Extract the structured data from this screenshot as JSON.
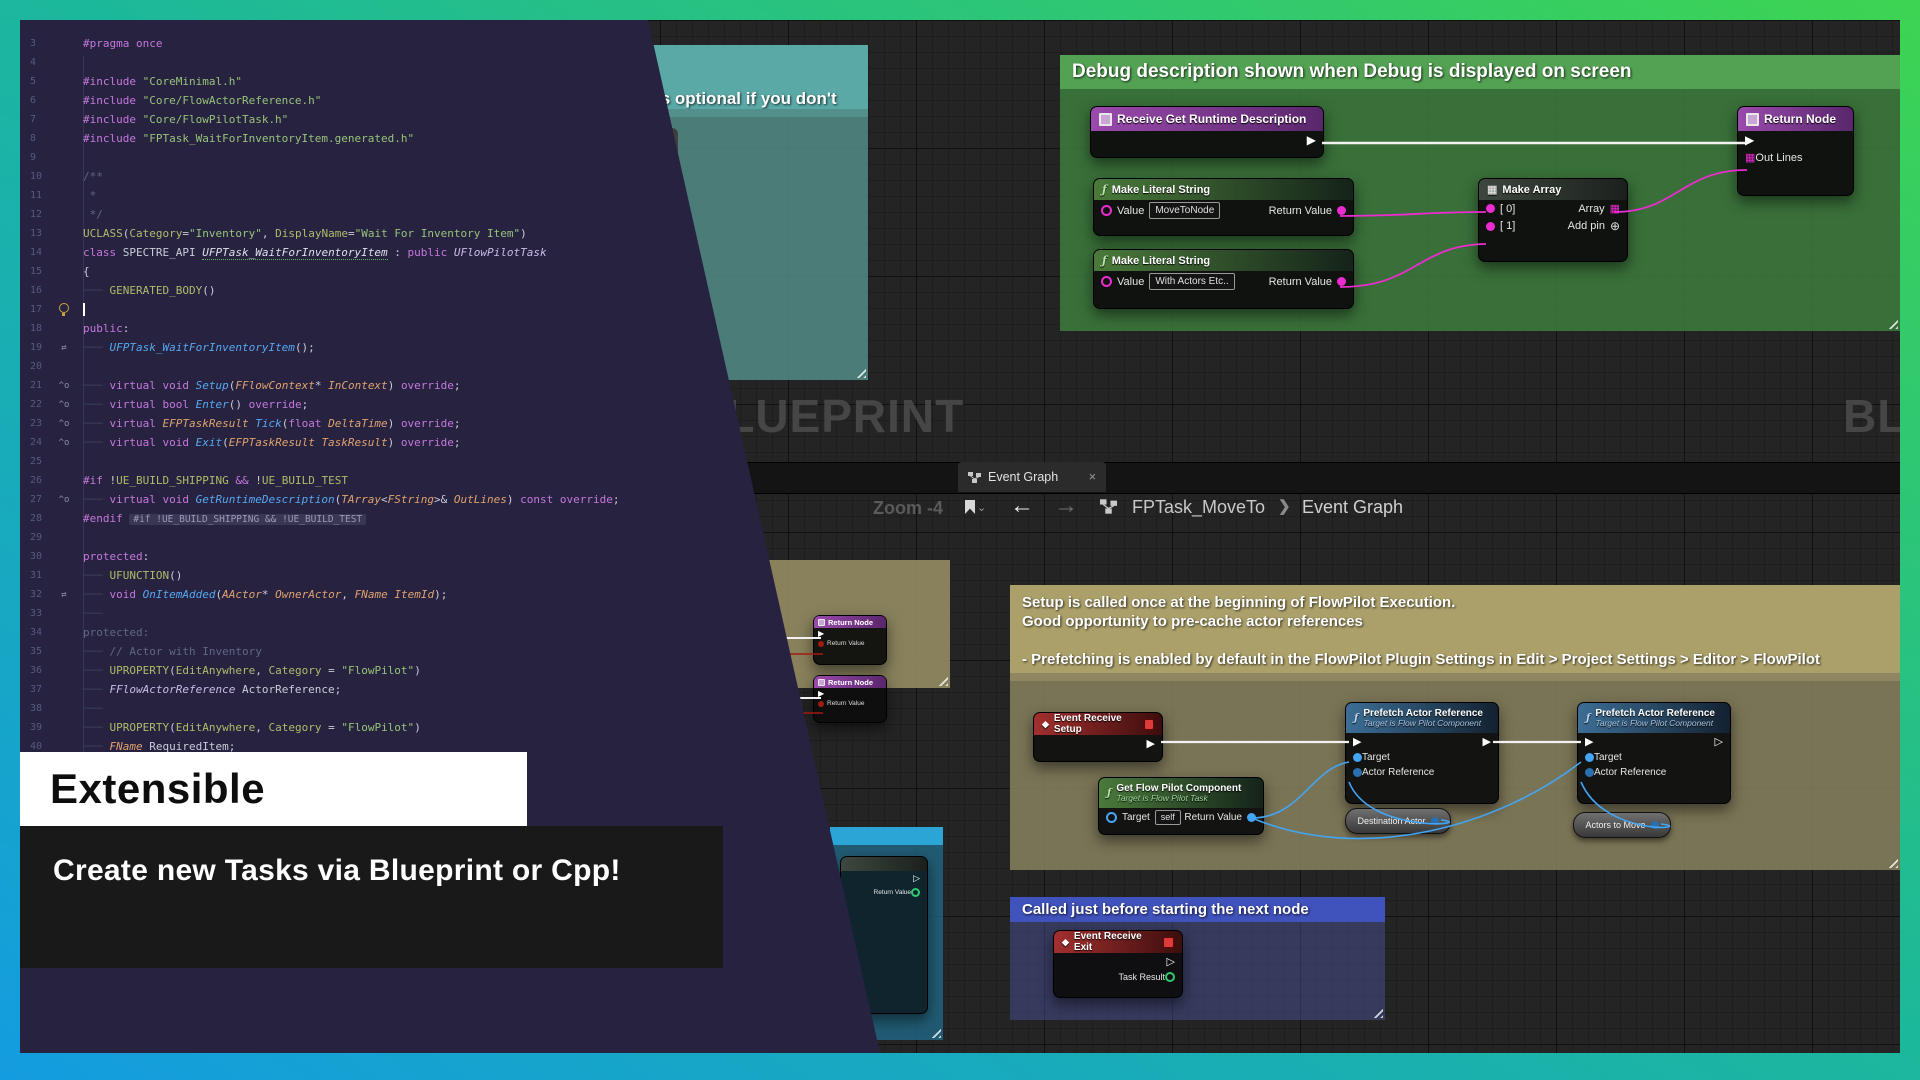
{
  "banners": {
    "title": "Extensible",
    "subtitle": "Create new Tasks via Blueprint or Cpp!"
  },
  "watermark": "BLUEPRINT",
  "ui": {
    "tab": "Event Graph",
    "zoom_label": "Zoom -4",
    "breadcrumb_parent": "FPTask_MoveTo",
    "breadcrumb_child": "Event Graph"
  },
  "icons": {
    "exec": "▶",
    "exec_hollow": "▷",
    "diamond": "◆",
    "fn": "ƒ",
    "grid": "▦",
    "add": "⊕",
    "close": "×",
    "chevron": "❯",
    "back": "←",
    "fwd": "→",
    "caret_down": "⌄"
  },
  "comments": {
    "debug": "Debug description shown when Debug is displayed on screen",
    "optional": "is optional if you don't",
    "setup_line1": "Setup is called once at the beginning of FlowPilot Execution.",
    "setup_line2": "Good opportunity to pre-cache actor references",
    "setup_line3": "- Prefetching is enabled by default in the FlowPilot Plugin Settings in Edit > Project Settings > Editor > FlowPilot",
    "exit": "Called just before starting the next node"
  },
  "nodes": {
    "receive": "Receive Get Runtime Description",
    "return_node": "Return Node",
    "out_lines": "Out Lines",
    "make_literal_string": "Make Literal String",
    "value": "Value",
    "mls1_value": "MoveToNode",
    "mls2_value": "With Actors Etc..",
    "return_value": "Return Value",
    "make_array": "Make Array",
    "idx0": "[ 0]",
    "idx1": "[ 1]",
    "array": "Array",
    "add_pin": "Add pin",
    "event_setup": "Event Receive Setup",
    "get_fpc": "Get Flow Pilot Component",
    "target_is_task": "Target is Flow Pilot Task",
    "target_is_comp": "Target is Flow Pilot Component",
    "target": "Target",
    "self_value": "self",
    "prefetch": "Prefetch Actor Reference",
    "actor_reference": "Actor Reference",
    "destination_actor": "Destination Actor",
    "actors_to_move": "Actors to Move",
    "event_exit": "Event Receive Exit",
    "task_result": "Task Result"
  },
  "colors": {
    "accent_green": "#3ed452",
    "accent_teal": "#1cb89b",
    "accent_blue": "#149ce0",
    "comment_green": "#53a253",
    "comment_tan": "#aca06a",
    "comment_blue": "#4052bb",
    "comment_teal": "#5aa9a6",
    "wire_pink": "#ec2bd0",
    "wire_blue": "#42a5f5",
    "wire_red": "#a11b10"
  },
  "editor": {
    "lines": [
      {
        "n": 3,
        "i": "",
        "s": [
          [
            "cp",
            "#pragma once"
          ]
        ]
      },
      {
        "n": 4,
        "i": "",
        "s": []
      },
      {
        "n": 5,
        "i": "",
        "s": [
          [
            "cp",
            "#include "
          ],
          [
            "cs",
            "\"CoreMinimal.h\""
          ]
        ]
      },
      {
        "n": 6,
        "i": "",
        "s": [
          [
            "cp",
            "#include "
          ],
          [
            "cs",
            "\"Core/FlowActorReference.h\""
          ]
        ]
      },
      {
        "n": 7,
        "i": "",
        "s": [
          [
            "cp",
            "#include "
          ],
          [
            "cs",
            "\"Core/FlowPilotTask.h\""
          ]
        ]
      },
      {
        "n": 8,
        "i": "",
        "s": [
          [
            "cp",
            "#include "
          ],
          [
            "cs",
            "\"FPTask_WaitForInventoryItem.generated.h\""
          ]
        ]
      },
      {
        "n": 9,
        "i": "",
        "s": []
      },
      {
        "n": 10,
        "i": "",
        "s": [
          [
            "cc",
            "/**"
          ]
        ]
      },
      {
        "n": 11,
        "i": "",
        "s": [
          [
            "cc",
            " *"
          ]
        ]
      },
      {
        "n": 12,
        "i": "",
        "s": [
          [
            "cc",
            " */"
          ]
        ]
      },
      {
        "n": 13,
        "i": "",
        "s": [
          [
            "cm",
            "UCLASS"
          ],
          [
            "cn",
            "("
          ],
          [
            "cm",
            "Category"
          ],
          [
            "cn",
            "="
          ],
          [
            "cs",
            "\"Inventory\""
          ],
          [
            "cn",
            ", "
          ],
          [
            "cm",
            "DisplayName"
          ],
          [
            "cn",
            "="
          ],
          [
            "cs",
            "\"Wait For Inventory Item\""
          ],
          [
            "cn",
            ")"
          ]
        ]
      },
      {
        "n": 14,
        "i": "",
        "s": [
          [
            "cp",
            "class "
          ],
          [
            "cn",
            "SPECTRE_API "
          ],
          [
            "cu",
            "UFPTask_WaitForInventoryItem"
          ],
          [
            "cn",
            " : "
          ],
          [
            "cp",
            "public "
          ],
          [
            "clv",
            "UFlowPilotTask"
          ]
        ]
      },
      {
        "n": 15,
        "i": "",
        "s": [
          [
            "cn",
            "{"
          ]
        ]
      },
      {
        "n": 16,
        "i": "",
        "s": [
          [
            "cd",
            "─── "
          ],
          [
            "cm",
            "GENERATED_BODY"
          ],
          [
            "cn",
            "()"
          ]
        ]
      },
      {
        "n": 17,
        "i": "bulb",
        "s": []
      },
      {
        "n": 18,
        "i": "",
        "s": [
          [
            "cp",
            "public"
          ],
          [
            "cn",
            ":"
          ]
        ]
      },
      {
        "n": 19,
        "i": "swap",
        "s": [
          [
            "cd",
            "─── "
          ],
          [
            "cf",
            "UFPTask_WaitForInventoryItem"
          ],
          [
            "cn",
            "();"
          ]
        ]
      },
      {
        "n": 20,
        "i": "",
        "s": []
      },
      {
        "n": 21,
        "i": "ovr",
        "s": [
          [
            "cd",
            "─── "
          ],
          [
            "cp",
            "virtual void "
          ],
          [
            "cf",
            "Setup"
          ],
          [
            "cn",
            "("
          ],
          [
            "ctp",
            "FFlowContext"
          ],
          [
            "cn",
            "* "
          ],
          [
            "ctp",
            "InContext"
          ],
          [
            "cn",
            ") "
          ],
          [
            "cp",
            "override"
          ],
          [
            "cn",
            ";"
          ]
        ]
      },
      {
        "n": 22,
        "i": "ovr",
        "s": [
          [
            "cd",
            "─── "
          ],
          [
            "cp",
            "virtual bool "
          ],
          [
            "cf",
            "Enter"
          ],
          [
            "cn",
            "() "
          ],
          [
            "cp",
            "override"
          ],
          [
            "cn",
            ";"
          ]
        ]
      },
      {
        "n": 23,
        "i": "ovr",
        "s": [
          [
            "cd",
            "─── "
          ],
          [
            "cp",
            "virtual "
          ],
          [
            "ctp",
            "EFPTaskResult "
          ],
          [
            "cf",
            "Tick"
          ],
          [
            "cn",
            "("
          ],
          [
            "cp",
            "float "
          ],
          [
            "ctp",
            "DeltaTime"
          ],
          [
            "cn",
            ") "
          ],
          [
            "cp",
            "override"
          ],
          [
            "cn",
            ";"
          ]
        ]
      },
      {
        "n": 24,
        "i": "ovr",
        "s": [
          [
            "cd",
            "─── "
          ],
          [
            "cp",
            "virtual void "
          ],
          [
            "cf",
            "Exit"
          ],
          [
            "cn",
            "("
          ],
          [
            "ctp",
            "EFPTaskResult "
          ],
          [
            "ctp",
            "TaskResult"
          ],
          [
            "cn",
            ") "
          ],
          [
            "cp",
            "override"
          ],
          [
            "cn",
            ";"
          ]
        ]
      },
      {
        "n": 25,
        "i": "",
        "s": []
      },
      {
        "n": 26,
        "i": "",
        "s": [
          [
            "cp",
            "#if "
          ],
          [
            "cn",
            "!"
          ],
          [
            "cm",
            "UE_BUILD_SHIPPING"
          ],
          [
            "cp",
            " && "
          ],
          [
            "cn",
            "!"
          ],
          [
            "cm",
            "UE_BUILD_TEST"
          ]
        ]
      },
      {
        "n": 27,
        "i": "ovr",
        "s": [
          [
            "cd",
            "─── "
          ],
          [
            "cp",
            "virtual void "
          ],
          [
            "cf",
            "GetRuntimeDescription"
          ],
          [
            "cn",
            "("
          ],
          [
            "ctp",
            "TArray"
          ],
          [
            "cn",
            "<"
          ],
          [
            "ctp",
            "FString"
          ],
          [
            "cn",
            ">& "
          ],
          [
            "ctp",
            "OutLines"
          ],
          [
            "cn",
            ") "
          ],
          [
            "cp",
            "const override"
          ],
          [
            "cn",
            ";"
          ]
        ]
      },
      {
        "n": 28,
        "i": "",
        "s": [
          [
            "cp",
            "#endif "
          ],
          [
            "chint",
            "#if !UE_BUILD_SHIPPING && !UE_BUILD_TEST"
          ]
        ]
      },
      {
        "n": 29,
        "i": "",
        "s": []
      },
      {
        "n": 30,
        "i": "",
        "s": [
          [
            "cp",
            "protected"
          ],
          [
            "cn",
            ":"
          ]
        ]
      },
      {
        "n": 31,
        "i": "",
        "s": [
          [
            "cd",
            "─── "
          ],
          [
            "cm",
            "UFUNCTION"
          ],
          [
            "cn",
            "()"
          ]
        ]
      },
      {
        "n": 32,
        "i": "swap",
        "s": [
          [
            "cd",
            "─── "
          ],
          [
            "cp",
            "void "
          ],
          [
            "cf",
            "OnItemAdded"
          ],
          [
            "cn",
            "("
          ],
          [
            "ctp",
            "AActor"
          ],
          [
            "cn",
            "* "
          ],
          [
            "ctp",
            "OwnerActor"
          ],
          [
            "cn",
            ", "
          ],
          [
            "ctp",
            "FName "
          ],
          [
            "ctp",
            "ItemId"
          ],
          [
            "cn",
            ");"
          ]
        ]
      },
      {
        "n": 33,
        "i": "",
        "s": [
          [
            "cd",
            "───"
          ]
        ]
      },
      {
        "n": 34,
        "i": "",
        "s": [
          [
            "cc",
            "protected:"
          ]
        ]
      },
      {
        "n": 35,
        "i": "",
        "s": [
          [
            "cd",
            "─── "
          ],
          [
            "cc",
            "// Actor with Inventory"
          ]
        ]
      },
      {
        "n": 36,
        "i": "",
        "s": [
          [
            "cd",
            "─── "
          ],
          [
            "cm",
            "UPROPERTY"
          ],
          [
            "cn",
            "("
          ],
          [
            "cm",
            "EditAnywhere"
          ],
          [
            "cn",
            ", "
          ],
          [
            "cm",
            "Category"
          ],
          [
            "cn",
            " = "
          ],
          [
            "cs",
            "\"FlowPilot\""
          ],
          [
            "cn",
            ")"
          ]
        ]
      },
      {
        "n": 37,
        "i": "",
        "s": [
          [
            "cd",
            "─── "
          ],
          [
            "clv",
            "FFlowActorReference "
          ],
          [
            "cn",
            "ActorReference;"
          ]
        ]
      },
      {
        "n": 38,
        "i": "",
        "s": [
          [
            "cd",
            "───"
          ]
        ]
      },
      {
        "n": 39,
        "i": "",
        "s": [
          [
            "cd",
            "─── "
          ],
          [
            "cm",
            "UPROPERTY"
          ],
          [
            "cn",
            "("
          ],
          [
            "cm",
            "EditAnywhere"
          ],
          [
            "cn",
            ", "
          ],
          [
            "cm",
            "Category"
          ],
          [
            "cn",
            " = "
          ],
          [
            "cs",
            "\"FlowPilot\""
          ],
          [
            "cn",
            ")"
          ]
        ]
      },
      {
        "n": 40,
        "i": "",
        "s": [
          [
            "cd",
            "─── "
          ],
          [
            "ctp",
            "FName "
          ],
          [
            "cn",
            "RequiredItem;"
          ]
        ]
      }
    ]
  }
}
